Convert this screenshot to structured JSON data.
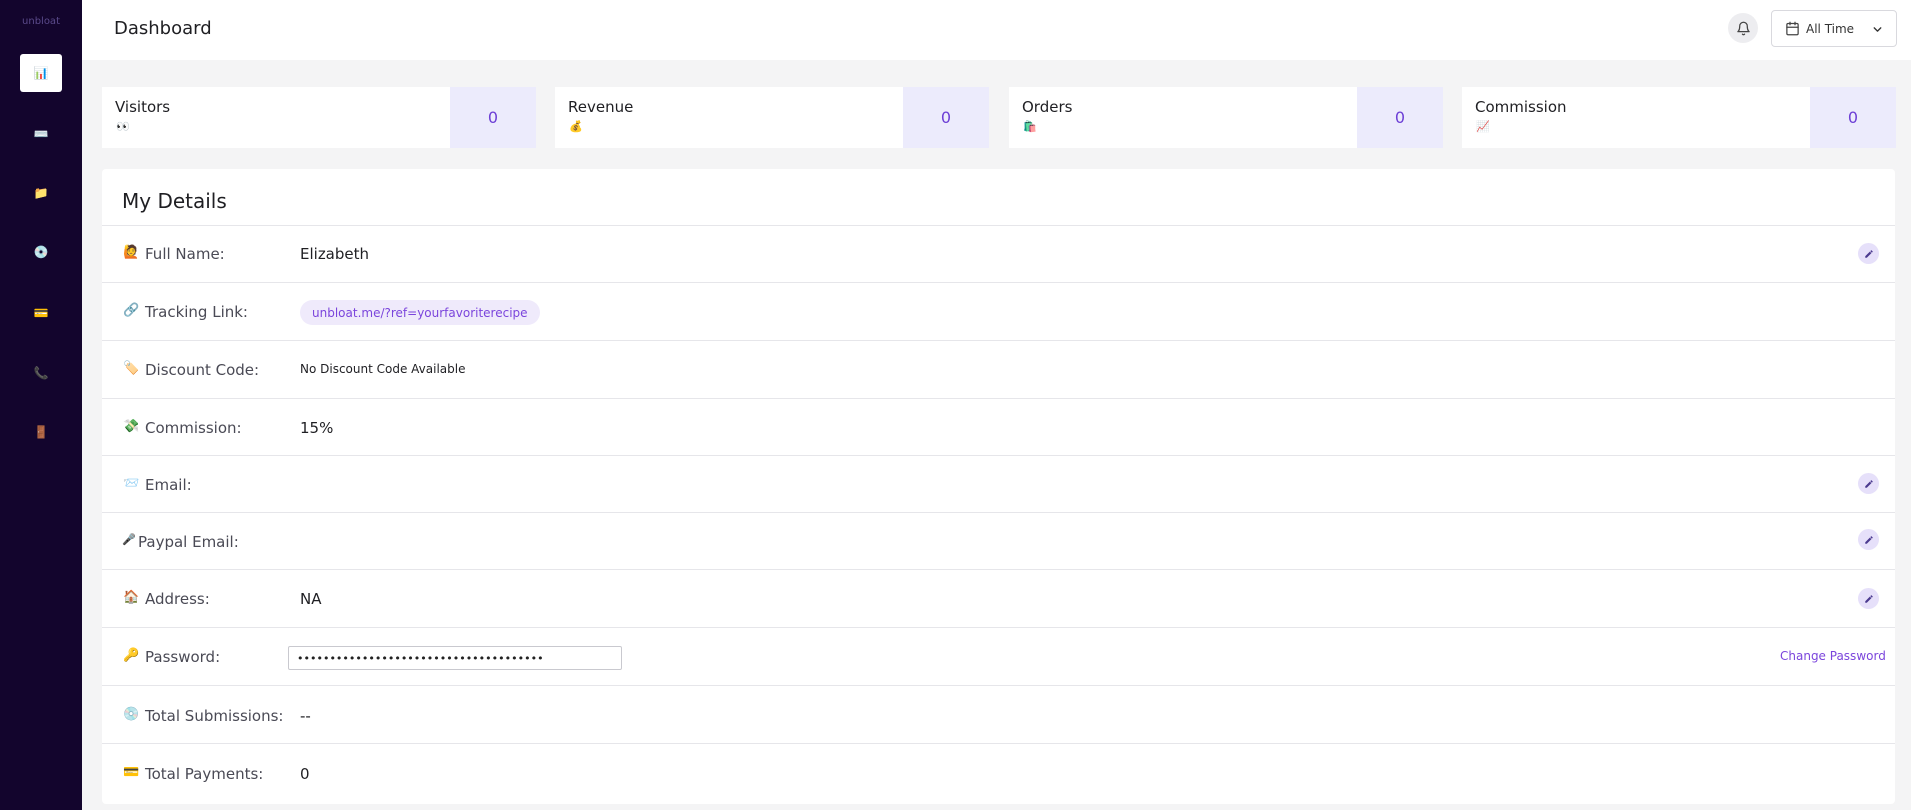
{
  "app": {
    "brand": "unbloat"
  },
  "sidebar": {
    "items": [
      {
        "name": "dashboard",
        "icon": "bar-chart-icon",
        "glyph": "📊",
        "active": true
      },
      {
        "name": "keyboard",
        "icon": "keyboard-icon",
        "glyph": "⌨️",
        "active": false
      },
      {
        "name": "folder",
        "icon": "folder-icon",
        "glyph": "📁",
        "active": false
      },
      {
        "name": "disc",
        "icon": "disc-icon",
        "glyph": "💿",
        "active": false
      },
      {
        "name": "payments",
        "icon": "credit-card-icon",
        "glyph": "💳",
        "active": false
      },
      {
        "name": "support",
        "icon": "phone-icon",
        "glyph": "📞",
        "active": false
      },
      {
        "name": "logout",
        "icon": "door-icon",
        "glyph": "🚪",
        "active": false
      }
    ]
  },
  "header": {
    "title": "Dashboard",
    "range_label": "All Time"
  },
  "stats": [
    {
      "label": "Visitors",
      "emoji": "👀",
      "value": "0"
    },
    {
      "label": "Revenue",
      "emoji": "💰",
      "value": "0"
    },
    {
      "label": "Orders",
      "emoji": "🛍️",
      "value": "0"
    },
    {
      "label": "Commission",
      "emoji": "📈",
      "value": "0"
    }
  ],
  "details": {
    "title": "My Details",
    "rows": {
      "full_name": {
        "emoji": "🙋",
        "label": "Full Name:",
        "value": "Elizabeth"
      },
      "tracking_link": {
        "emoji": "🔗",
        "label": "Tracking Link:",
        "value": "unbloat.me/?ref=yourfavoriterecipe"
      },
      "discount_code": {
        "emoji": "🏷️",
        "label": "Discount Code:",
        "value": "No Discount Code Available"
      },
      "commission": {
        "emoji": "💸",
        "label": "Commission:",
        "value": "15%"
      },
      "email": {
        "emoji": "📨",
        "label": "Email:",
        "value": ""
      },
      "paypal_email": {
        "emoji": "🎤",
        "label": "Paypal Email:",
        "value": ""
      },
      "address": {
        "emoji": "🏠",
        "label": "Address:",
        "value": "NA"
      },
      "password": {
        "emoji": "🔑",
        "label": "Password:",
        "value": "••••••••••••••••••••••••••••••••••••••",
        "action": "Change Password"
      },
      "total_submissions": {
        "emoji": "💿",
        "label": "Total Submissions:",
        "value": "--"
      },
      "total_payments": {
        "emoji": "💳",
        "label": "Total Payments:",
        "value": "0"
      }
    }
  },
  "colors": {
    "sidebar_bg": "#13052d",
    "accent": "#7b45dc",
    "stat_value_bg": "#ecebfc",
    "page_bg": "#f4f4f5"
  }
}
